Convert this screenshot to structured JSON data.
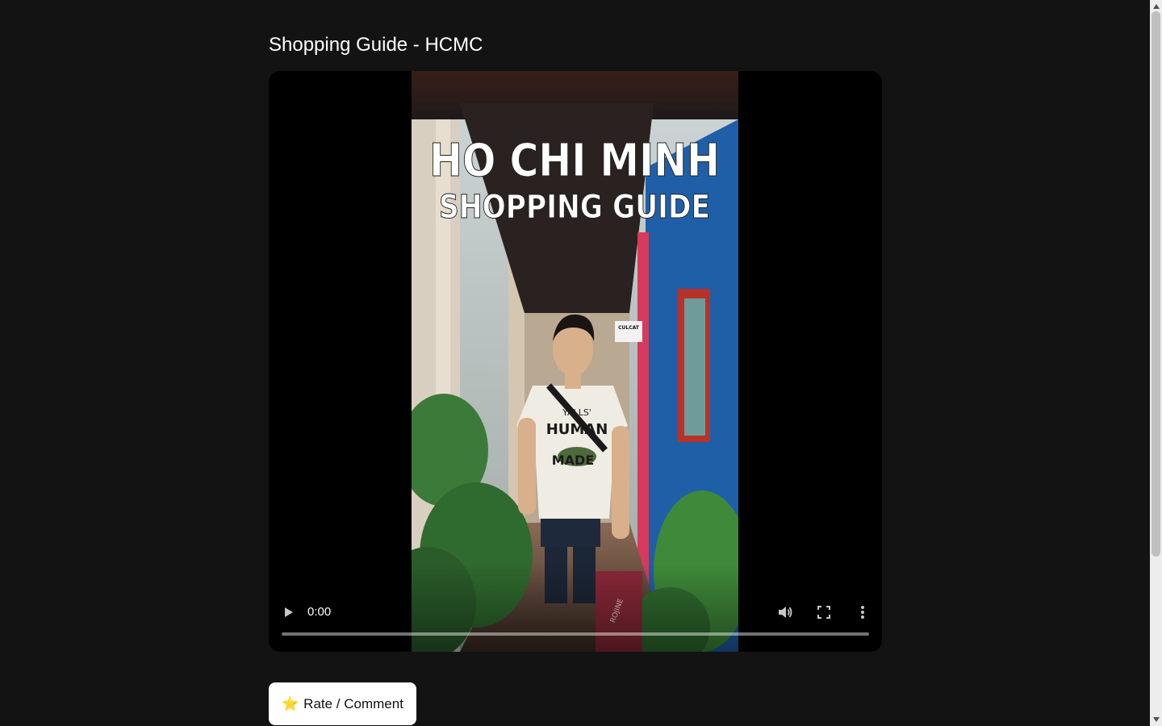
{
  "page": {
    "title": "Shopping Guide - HCMC"
  },
  "video": {
    "overlay_title_line1": "HO CHI MINH",
    "overlay_title_line2": "SHOPPING GUIDE",
    "shirt_text_top": "YALLS'",
    "shirt_text_middle": "HUMAN",
    "shirt_text_bottom": "MADE",
    "shop_sign": "CULCAT",
    "bag_text": "ROJINE",
    "current_time": "0:00",
    "progress_percent": 0,
    "icons": {
      "play": "play-icon",
      "volume": "volume-icon",
      "fullscreen": "fullscreen-icon",
      "more": "more-vert-icon"
    }
  },
  "actions": {
    "rate_icon": "⭐",
    "rate_label": "Rate / Comment"
  },
  "colors": {
    "background": "#131313",
    "player_background": "#000000",
    "button_background": "#ffffff",
    "accent_wall": "#1f5fa8"
  }
}
